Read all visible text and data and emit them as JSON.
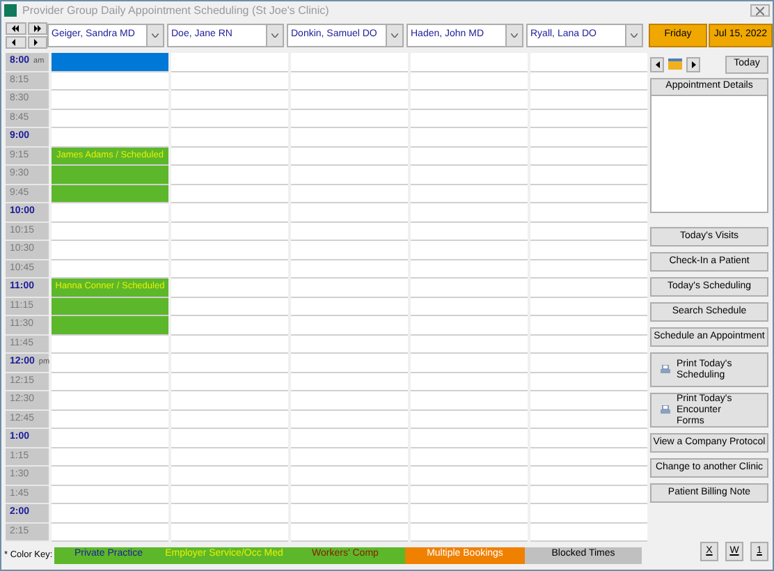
{
  "window": {
    "title": "Provider Group Daily Appointment Scheduling (St Joe's Clinic)"
  },
  "day": "Friday",
  "date": "Jul 15, 2022",
  "times": [
    {
      "label": "8:00",
      "kind": "hour",
      "suffix": "am"
    },
    {
      "label": "8:15",
      "kind": "quarter"
    },
    {
      "label": "8:30",
      "kind": "quarter"
    },
    {
      "label": "8:45",
      "kind": "quarter"
    },
    {
      "label": "9:00",
      "kind": "hour"
    },
    {
      "label": "9:15",
      "kind": "quarter"
    },
    {
      "label": "9:30",
      "kind": "quarter"
    },
    {
      "label": "9:45",
      "kind": "quarter"
    },
    {
      "label": "10:00",
      "kind": "hour"
    },
    {
      "label": "10:15",
      "kind": "quarter"
    },
    {
      "label": "10:30",
      "kind": "quarter"
    },
    {
      "label": "10:45",
      "kind": "quarter"
    },
    {
      "label": "11:00",
      "kind": "hour"
    },
    {
      "label": "11:15",
      "kind": "quarter"
    },
    {
      "label": "11:30",
      "kind": "quarter"
    },
    {
      "label": "11:45",
      "kind": "quarter"
    },
    {
      "label": "12:00",
      "kind": "hour",
      "suffix": "pm"
    },
    {
      "label": "12:15",
      "kind": "quarter"
    },
    {
      "label": "12:30",
      "kind": "quarter"
    },
    {
      "label": "12:45",
      "kind": "quarter"
    },
    {
      "label": "1:00",
      "kind": "hour"
    },
    {
      "label": "1:15",
      "kind": "quarter"
    },
    {
      "label": "1:30",
      "kind": "quarter"
    },
    {
      "label": "1:45",
      "kind": "quarter"
    },
    {
      "label": "2:00",
      "kind": "hour"
    },
    {
      "label": "2:15",
      "kind": "quarter"
    }
  ],
  "providers": [
    {
      "name": "Geiger, Sandra  MD",
      "slots": [
        {
          "kind": "selected"
        },
        {
          "kind": "free"
        },
        {
          "kind": "free"
        },
        {
          "kind": "free"
        },
        {
          "kind": "free"
        },
        {
          "kind": "booked",
          "text": "James Adams / Scheduled"
        },
        {
          "kind": "booked"
        },
        {
          "kind": "booked"
        },
        {
          "kind": "free"
        },
        {
          "kind": "free"
        },
        {
          "kind": "free"
        },
        {
          "kind": "free"
        },
        {
          "kind": "booked",
          "text": "Hanna Conner / Scheduled"
        },
        {
          "kind": "booked"
        },
        {
          "kind": "booked"
        },
        {
          "kind": "free"
        },
        {
          "kind": "free"
        },
        {
          "kind": "free"
        },
        {
          "kind": "free"
        },
        {
          "kind": "free"
        },
        {
          "kind": "free"
        },
        {
          "kind": "free"
        },
        {
          "kind": "free"
        },
        {
          "kind": "free"
        },
        {
          "kind": "free"
        },
        {
          "kind": "free"
        }
      ]
    },
    {
      "name": "Doe, Jane  RN"
    },
    {
      "name": "Donkin, Samuel  DO"
    },
    {
      "name": "Haden, John  MD"
    },
    {
      "name": "Ryall, Lana  DO"
    }
  ],
  "panel": {
    "today_button": "Today",
    "details_header": "Appointment Details",
    "actions": [
      {
        "label": "Today's Visits",
        "kind": "plain"
      },
      {
        "label": "Check-In a Patient",
        "kind": "plain"
      },
      {
        "label": "Today's Scheduling",
        "kind": "plain"
      },
      {
        "label": "Search Schedule",
        "kind": "plain"
      },
      {
        "label": "Schedule an Appointment",
        "kind": "plain"
      },
      {
        "label": "Print Today's Scheduling",
        "kind": "print"
      },
      {
        "label": "Print Today's Encounter Forms",
        "kind": "print"
      },
      {
        "label": "View a Company Protocol",
        "kind": "plain"
      },
      {
        "label": "Change to another Clinic",
        "kind": "plain"
      },
      {
        "label": "Patient Billing Note",
        "kind": "plain"
      }
    ],
    "bottom_buttons": [
      "X",
      "W",
      "1"
    ]
  },
  "color_key": {
    "label": "* Color Key:",
    "items": [
      {
        "label": "Private Practice",
        "kind": "private",
        "color": "#5cb82a"
      },
      {
        "label": "Employer Service/Occ Med",
        "kind": "employer",
        "color": "#5cb82a"
      },
      {
        "label": "Workers' Comp",
        "kind": "workers",
        "color": "#5cb82a"
      },
      {
        "label": "Multiple Bookings",
        "kind": "multiple",
        "color": "#f08000"
      },
      {
        "label": "Blocked Times",
        "kind": "blocked",
        "color": "#c0c0c0"
      }
    ]
  }
}
